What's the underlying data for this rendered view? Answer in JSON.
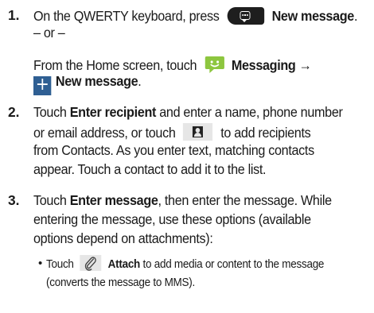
{
  "steps": [
    {
      "number": "1.",
      "line1": {
        "before": "On the QWERTY keyboard, press",
        "bold": "New message",
        "after": "."
      },
      "or": "– or –",
      "line3": "From the Home screen, touch",
      "line3_bold": "Messaging →",
      "line4_bold": "New message",
      "line4_after": "."
    },
    {
      "number": "2.",
      "l1_before": "Touch",
      "l1_bold": "Enter recipient",
      "l1_after": "and enter a name, phone number",
      "l2_before": "or email address, or touch",
      "l2_after": "to add recipients",
      "l3": "from Contacts. As you enter text, matching contacts",
      "l4": "appear. Touch a contact to add it to the list."
    },
    {
      "number": "3.",
      "l1_before": "Touch",
      "l1_bold": "Enter message",
      "l1_after": ", then enter the message. While",
      "l2": "entering the message, use these options (available",
      "l3": "options depend on attachments):",
      "bullets": [
        {
          "symbol": "•",
          "before": "Touch",
          "bold": "Attach",
          "after": "to add media or content to the message",
          "line2": "(converts the message to MMS)."
        }
      ]
    }
  ],
  "icons": {
    "keyboard_message_key": "message-key-icon",
    "messaging_app": "messaging-app-icon",
    "new_message": "plus-icon",
    "contacts": "contact-card-icon",
    "attach": "paperclip-icon"
  },
  "colors": {
    "plus_icon_bg": "#2f5f93",
    "messaging_green": "#8dc63f"
  }
}
